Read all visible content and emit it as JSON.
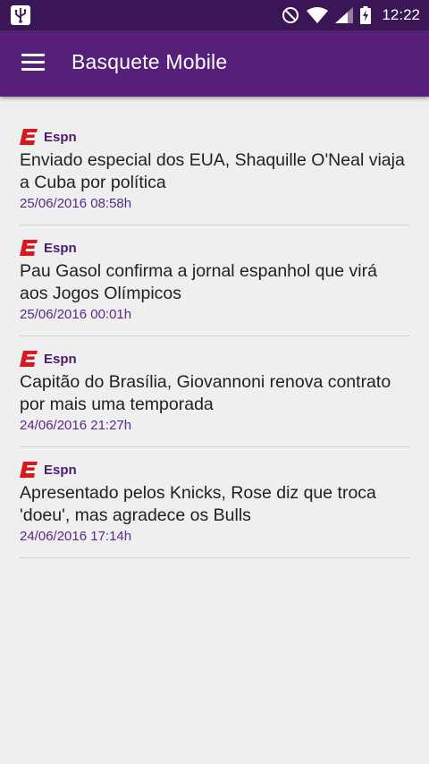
{
  "status_bar": {
    "time": "12:22",
    "icons": [
      "usb-icon",
      "do-not-disturb-icon",
      "wifi-icon",
      "signal-icon",
      "battery-charging-icon"
    ]
  },
  "app_bar": {
    "title": "Basquete Mobile",
    "menu_icon": "hamburger-menu-icon"
  },
  "colors": {
    "status_bar": "#3b1656",
    "app_bar": "#56207a",
    "date_text": "#5a2a85",
    "espn_red": "#d7191f"
  },
  "news": [
    {
      "source": "Espn",
      "headline": "Enviado especial dos EUA, Shaquille O'Neal viaja a Cuba por política",
      "date": "25/06/2016 08:58h"
    },
    {
      "source": "Espn",
      "headline": "Pau Gasol confirma a jornal espanhol que virá aos Jogos Olímpicos",
      "date": "25/06/2016 00:01h"
    },
    {
      "source": "Espn",
      "headline": "Capitão do Brasília, Giovannoni renova contrato por mais uma temporada",
      "date": "24/06/2016 21:27h"
    },
    {
      "source": "Espn",
      "headline": "Apresentado pelos Knicks, Rose diz que troca 'doeu', mas agradece os Bulls",
      "date": "24/06/2016 17:14h"
    }
  ]
}
